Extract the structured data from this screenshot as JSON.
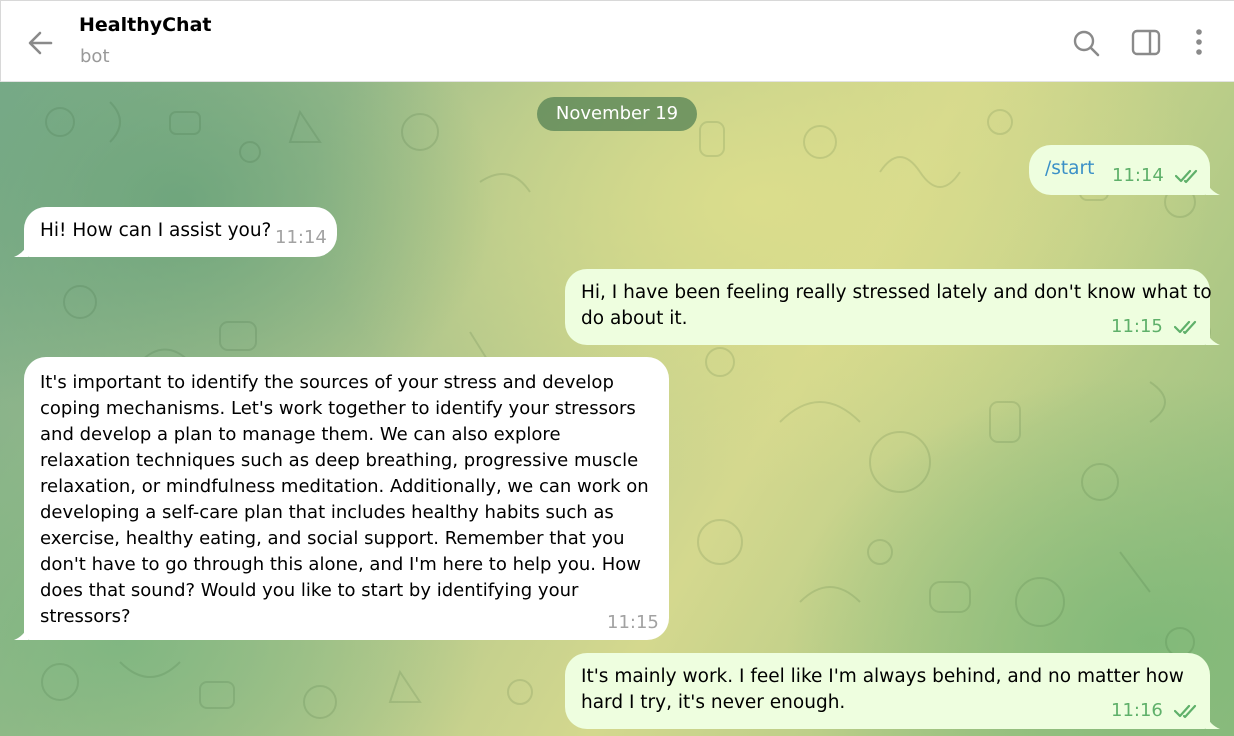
{
  "header": {
    "title": "HealthyChat",
    "subtitle": "bot"
  },
  "chat": {
    "date": "November 19",
    "messages": [
      {
        "from": "out",
        "text": "/start",
        "time": "11:14"
      },
      {
        "from": "in",
        "text": "Hi! How can I assist you?",
        "time": "11:14"
      },
      {
        "from": "out",
        "text_lines": [
          "Hi, I have been feeling really stressed lately and don't know what to",
          "do about it."
        ],
        "time": "11:15"
      },
      {
        "from": "in",
        "text_lines": [
          "It's important to identify the sources of your stress and develop",
          "coping mechanisms. Let's work together to identify your stressors",
          "and develop a plan to manage them.  We can also explore",
          "relaxation techniques such as deep breathing, progressive muscle",
          "relaxation, or mindfulness meditation.  Additionally, we can work on",
          "developing a self-care plan that includes healthy habits such as",
          "exercise, healthy eating, and social support.  Remember that you",
          "don't have to go through this alone, and I'm here to help you.  How",
          "does that sound?  Would you like to start by identifying your",
          "stressors?"
        ],
        "time": "11:15"
      },
      {
        "from": "out",
        "text_lines": [
          "It's mainly work. I feel like I'm always behind, and no matter how",
          "hard I try, it's never enough."
        ],
        "time": "11:16"
      }
    ]
  },
  "icons": {
    "back": "arrow-left-icon",
    "search": "search-icon",
    "sidebar": "sidebar-toggle-icon",
    "menu": "more-vertical-icon",
    "read": "double-check-icon"
  },
  "colors": {
    "incoming_bubble": "#ffffff",
    "outgoing_bubble": "#eefedf",
    "outgoing_time": "#5fb06a",
    "incoming_time": "#a2a2a2",
    "command_link": "#3a90c7",
    "date_chip": "#548254"
  }
}
